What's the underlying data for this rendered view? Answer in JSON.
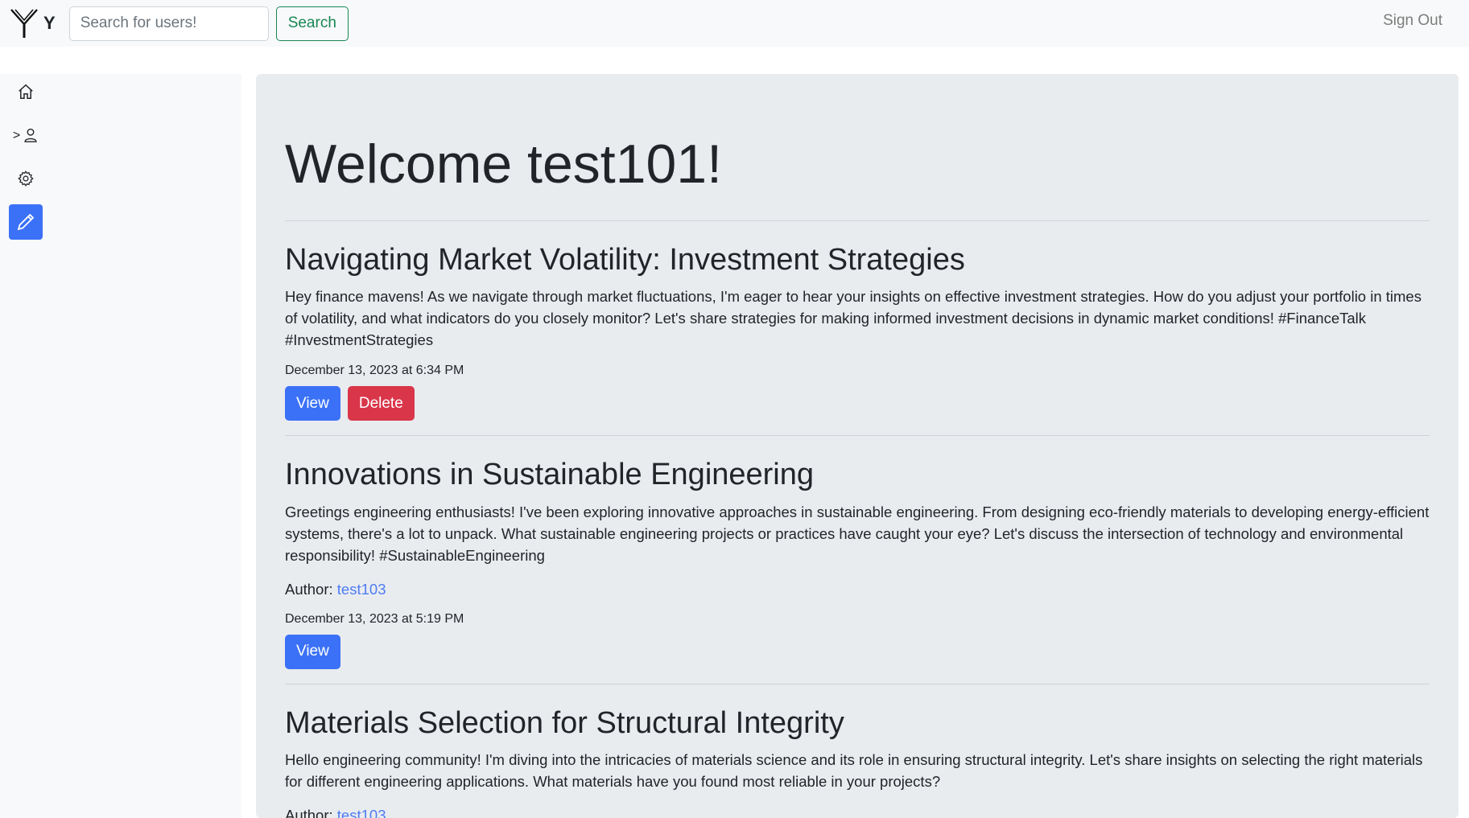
{
  "header": {
    "brand": "Y",
    "search_placeholder": "Search for users!",
    "search_button": "Search",
    "sign_out": "Sign Out"
  },
  "sidebar": {
    "items": [
      {
        "icon": "home-icon"
      },
      {
        "icon": "user-icon",
        "prefix": ">"
      },
      {
        "icon": "gear-icon"
      },
      {
        "icon": "pencil-icon",
        "active": true
      }
    ]
  },
  "main": {
    "welcome": "Welcome test101!",
    "posts": [
      {
        "title": "Navigating Market Volatility: Investment Strategies",
        "body": "Hey finance mavens! As we navigate through market fluctuations, I'm eager to hear your insights on effective investment strategies. How do you adjust your portfolio in times of volatility, and what indicators do you closely monitor? Let's share strategies for making informed investment decisions in dynamic market conditions! #FinanceTalk #InvestmentStrategies",
        "date": "December 13, 2023 at 6:34 PM",
        "view_label": "View",
        "delete_label": "Delete"
      },
      {
        "title": "Innovations in Sustainable Engineering",
        "body": "Greetings engineering enthusiasts! I've been exploring innovative approaches in sustainable engineering. From designing eco-friendly materials to developing energy-efficient systems, there's a lot to unpack. What sustainable engineering projects or practices have caught your eye? Let's discuss the intersection of technology and environmental responsibility! #SustainableEngineering",
        "author_label": "Author:",
        "author": "test103",
        "date": "December 13, 2023 at 5:19 PM",
        "view_label": "View"
      },
      {
        "title": "Materials Selection for Structural Integrity",
        "body": "Hello engineering community! I'm diving into the intricacies of materials science and its role in ensuring structural integrity. Let's share insights on selecting the right materials for different engineering applications. What materials have you found most reliable in your projects?",
        "author_label": "Author:",
        "author": "test103"
      }
    ]
  },
  "colors": {
    "primary": "#3b71f7",
    "danger": "#d9364a",
    "success": "#198754",
    "link": "#4f7cf3"
  }
}
